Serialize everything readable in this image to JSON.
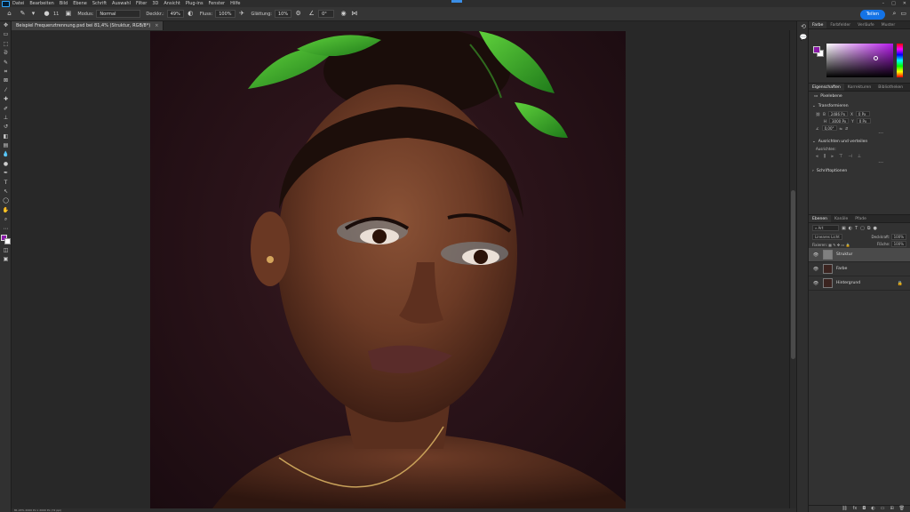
{
  "menu": [
    "Datei",
    "Bearbeiten",
    "Bild",
    "Ebene",
    "Schrift",
    "Auswahl",
    "Filter",
    "3D",
    "Ansicht",
    "Plug-ins",
    "Fenster",
    "Hilfe"
  ],
  "window_controls": {
    "min": "–",
    "max": "□",
    "close": "✕"
  },
  "options": {
    "brush_size": "11",
    "mode_label": "Modus:",
    "mode_value": "Normal",
    "opacity_label": "Deckkr.:",
    "opacity_value": "49%",
    "flow_label": "Fluss:",
    "flow_value": "100%",
    "smoothing_label": "Glättung:",
    "smoothing_value": "10%",
    "angle_value": "0°",
    "share_label": "Teilen"
  },
  "doc_tab": {
    "title": "Beispiel Frequenztrennung.psd bei 81,4% (Struktur, RGB/8*)",
    "close": "×"
  },
  "status": {
    "zoom": "81,43%",
    "info": "2000 Px x 2000 Px (72 ppi)"
  },
  "color_panel": {
    "tabs": [
      "Farbe",
      "Farbfelder",
      "Verläufe",
      "Muster"
    ],
    "active": 0,
    "foreground": "#8a1aa8",
    "background": "#ffffff"
  },
  "properties": {
    "tabs": [
      "Eigenschaften",
      "Korrekturen",
      "Bibliotheken"
    ],
    "active": 0,
    "layer_type": "Pixelebene",
    "transform_label": "Transformieren",
    "w_label": "B",
    "w_value": "2486 Px",
    "x_label": "X",
    "x_value": "0 Px",
    "h_label": "H",
    "h_value": "3000 Px",
    "y_label": "Y",
    "y_value": "0 Px",
    "angle_value": "0,00°",
    "align_label": "Ausrichten und verteilen",
    "align_sub": "Ausrichten:",
    "font_label": "Schriftoptionen"
  },
  "layers_panel": {
    "tabs": [
      "Ebenen",
      "Kanäle",
      "Pfade"
    ],
    "active": 0,
    "kind_label": "Art",
    "blend_mode": "Lineares Licht",
    "opacity_label": "Deckkraft:",
    "opacity_value": "100%",
    "lock_label": "Fixieren:",
    "fill_label": "Fläche:",
    "fill_value": "100%",
    "layers": [
      {
        "name": "Struktur",
        "selected": true,
        "thumb": "grey"
      },
      {
        "name": "Farbe",
        "selected": false,
        "thumb": "photo"
      },
      {
        "name": "Hintergrund",
        "selected": false,
        "thumb": "photo",
        "locked": true
      }
    ]
  },
  "tools": [
    "move-tool",
    "artboard-tool",
    "marquee-tool",
    "lasso-tool",
    "quick-select-tool",
    "crop-tool",
    "frame-tool",
    "eyedropper-tool",
    "healing-tool",
    "brush-tool",
    "stamp-tool",
    "history-brush-tool",
    "eraser-tool",
    "gradient-tool",
    "blur-tool",
    "dodge-tool",
    "pen-tool",
    "type-tool",
    "path-select-tool",
    "shape-tool",
    "hand-tool",
    "zoom-tool",
    "more-tool"
  ]
}
